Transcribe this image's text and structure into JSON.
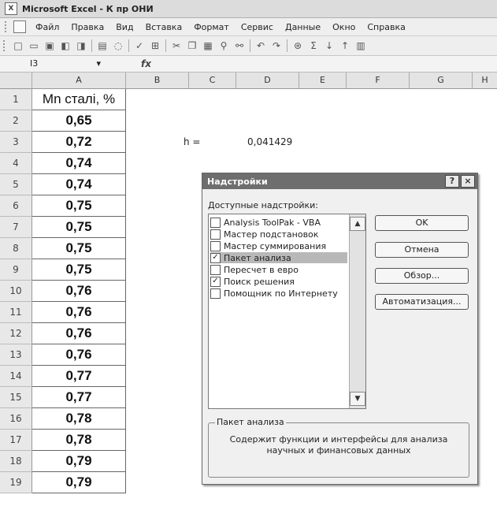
{
  "window": {
    "title": "Microsoft Excel - К пр ОНИ"
  },
  "menu": [
    "Файл",
    "Правка",
    "Вид",
    "Вставка",
    "Формат",
    "Сервис",
    "Данные",
    "Окно",
    "Справка"
  ],
  "formula_bar": {
    "cell_ref": "I3",
    "fx": "fx"
  },
  "columns": [
    "A",
    "B",
    "C",
    "D",
    "E",
    "F",
    "G",
    "H"
  ],
  "rows": [
    {
      "n": "1",
      "a": "Mn сталі, %"
    },
    {
      "n": "2",
      "a": "0,65"
    },
    {
      "n": "3",
      "a": "0,72"
    },
    {
      "n": "4",
      "a": "0,74"
    },
    {
      "n": "5",
      "a": "0,74"
    },
    {
      "n": "6",
      "a": "0,75"
    },
    {
      "n": "7",
      "a": "0,75"
    },
    {
      "n": "8",
      "a": "0,75"
    },
    {
      "n": "9",
      "a": "0,75"
    },
    {
      "n": "10",
      "a": "0,76"
    },
    {
      "n": "11",
      "a": "0,76"
    },
    {
      "n": "12",
      "a": "0,76"
    },
    {
      "n": "13",
      "a": "0,76"
    },
    {
      "n": "14",
      "a": "0,77"
    },
    {
      "n": "15",
      "a": "0,77"
    },
    {
      "n": "16",
      "a": "0,78"
    },
    {
      "n": "17",
      "a": "0,78"
    },
    {
      "n": "18",
      "a": "0,79"
    },
    {
      "n": "19",
      "a": "0,79"
    }
  ],
  "cells": {
    "h_label": "h =",
    "h_value": "0,041429"
  },
  "dialog": {
    "title": "Надстройки",
    "help": "?",
    "close": "×",
    "list_label": "Доступные надстройки:",
    "items": [
      {
        "label": "Analysis ToolPak - VBA",
        "checked": ""
      },
      {
        "label": "Мастер подстановок",
        "checked": ""
      },
      {
        "label": "Мастер суммирования",
        "checked": ""
      },
      {
        "label": "Пакет анализа",
        "checked": "✓"
      },
      {
        "label": "Пересчет в евро",
        "checked": ""
      },
      {
        "label": "Поиск решения",
        "checked": "✓"
      },
      {
        "label": "Помощник по Интернету",
        "checked": ""
      }
    ],
    "buttons": {
      "ok": "OK",
      "cancel": "Отмена",
      "browse": "Обзор...",
      "automation": "Автоматизация..."
    },
    "group_title": "Пакет анализа",
    "group_text": "Содержит функции и интерфейсы для анализа научных и финансовых данных"
  }
}
